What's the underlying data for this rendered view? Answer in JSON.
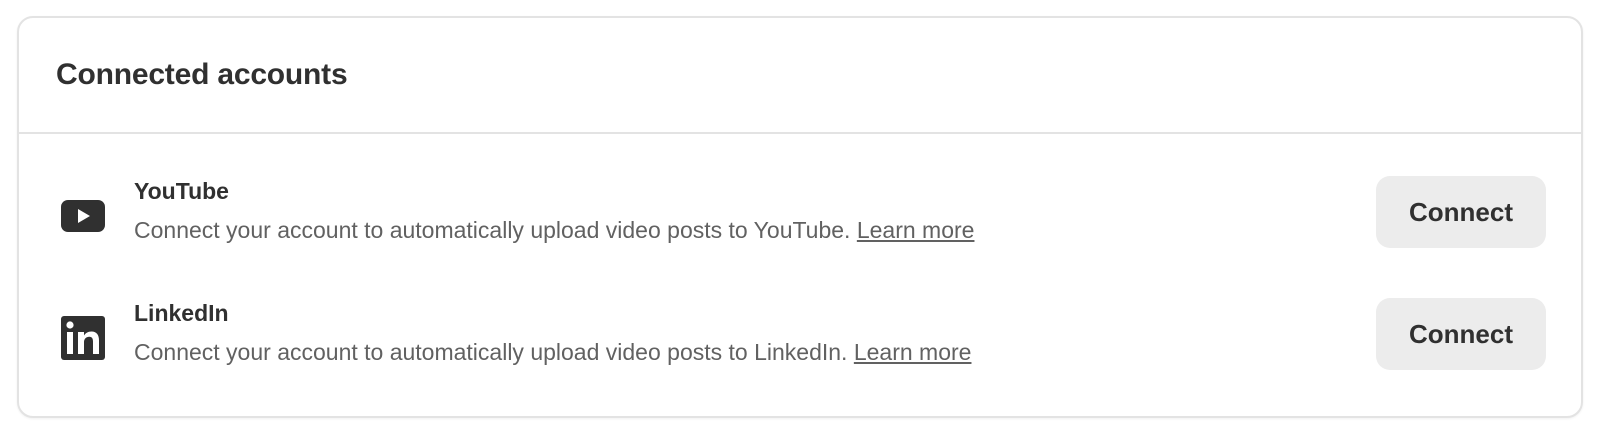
{
  "card": {
    "title": "Connected accounts"
  },
  "accounts": [
    {
      "name": "YouTube",
      "icon": "youtube-icon",
      "description": "Connect your account to automatically upload video posts to YouTube.",
      "learn_more": "Learn more",
      "button_label": "Connect"
    },
    {
      "name": "LinkedIn",
      "icon": "linkedin-icon",
      "description": "Connect your account to automatically upload video posts to LinkedIn.",
      "learn_more": "Learn more",
      "button_label": "Connect"
    }
  ],
  "colors": {
    "border": "#e3e3e3",
    "title_text": "#303030",
    "secondary_text": "#616161",
    "button_bg": "#ececec",
    "icon": "#303030"
  }
}
